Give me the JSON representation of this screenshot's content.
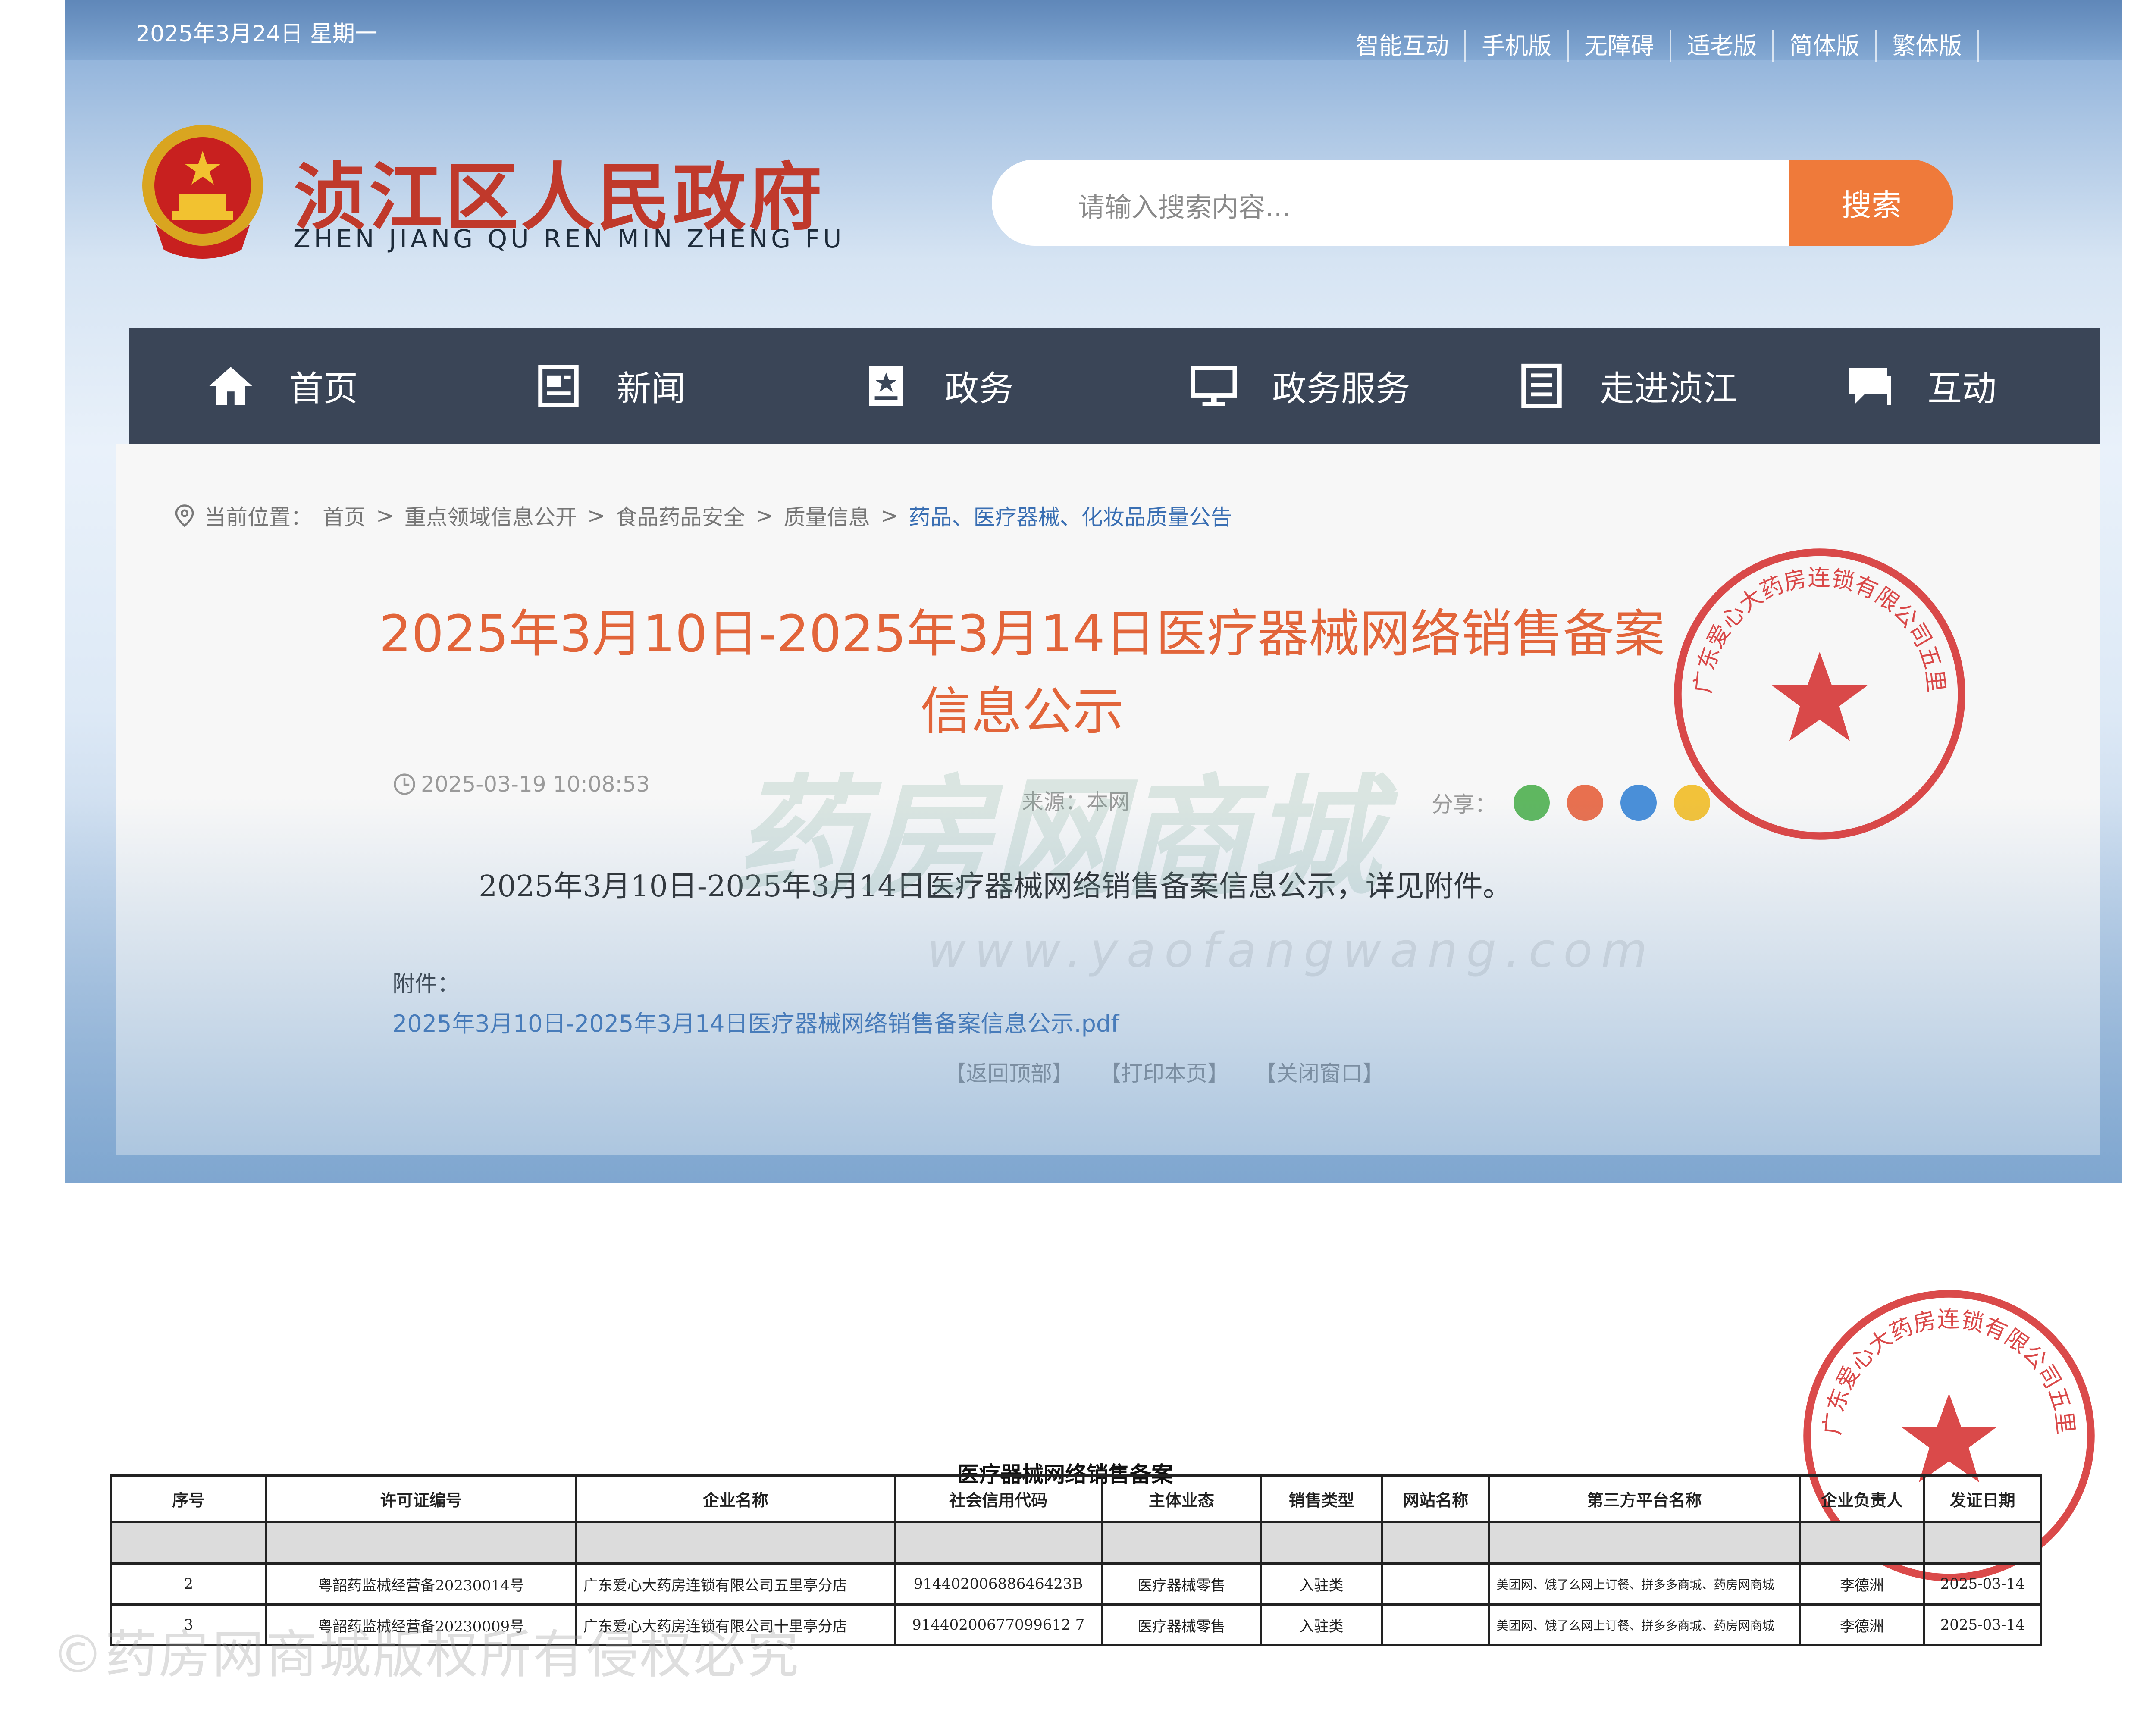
{
  "topbar": {
    "date": "2025年3月24日  星期一",
    "links": [
      "智能互动",
      "手机版",
      "无障碍",
      "适老版",
      "简体版",
      "繁体版"
    ]
  },
  "header": {
    "title": "浈江区人民政府",
    "pinyin": "ZHEN JIANG QU REN MIN ZHENG FU",
    "emblem_icon": "national-emblem-icon"
  },
  "search": {
    "placeholder": "请输入搜索内容...",
    "button_label": "搜索"
  },
  "nav": {
    "items": [
      {
        "label": "首页",
        "icon": "home-icon"
      },
      {
        "label": "新闻",
        "icon": "news-icon"
      },
      {
        "label": "政务",
        "icon": "government-icon"
      },
      {
        "label": "政务服务",
        "icon": "monitor-icon"
      },
      {
        "label": "走进浈江",
        "icon": "building-icon"
      },
      {
        "label": "互动",
        "icon": "chat-icon"
      }
    ]
  },
  "breadcrumb": {
    "prefix": "当前位置：",
    "items": [
      "首页",
      "重点领域信息公开",
      "食品药品安全",
      "质量信息",
      "药品、医疗器械、化妆品质量公告"
    ],
    "separator": ">"
  },
  "article": {
    "title": "2025年3月10日-2025年3月14日医疗器械网络销售备案信息公示",
    "date": "2025-03-19 10:08:53",
    "source": "来源：本网",
    "share_label": "分享：",
    "body": "2025年3月10日-2025年3月14日医疗器械网络销售备案信息公示，详见附件。",
    "attachment_label": "附件：",
    "attachment_link": "2025年3月10日-2025年3月14日医疗器械网络销售备案信息公示.pdf",
    "footer_links": [
      "【返回顶部】",
      "【打印本页】",
      "【关闭窗口】"
    ]
  },
  "watermark": {
    "brand": "药房网商城",
    "url": "www.yaofangwang.com",
    "copyright": "©药房网商城版权所有侵权必究"
  },
  "stamp": {
    "text": "广东爱心大药房连锁有限公司五里亭分店",
    "color": "#d42a2a"
  },
  "colors": {
    "nav_bg": "#3a4557",
    "search_button": "#ef7a3a",
    "title_accent": "#e2653a",
    "gov_title": "#c0392b",
    "link": "#3a6fb3"
  },
  "record_table": {
    "title": "医疗器械网络销售备案",
    "headers": [
      "序号",
      "许可证编号",
      "企业名称",
      "社会信用代码",
      "主体业态",
      "销售类型",
      "网站名称",
      "第三方平台名称",
      "企业负责人",
      "发证日期"
    ],
    "rows": [
      [
        "2",
        "粤韶药监械经营备20230014号",
        "广东爱心大药房连锁有限公司五里亭分店",
        "91440200688646423B",
        "医疗器械零售",
        "入驻类",
        "",
        "美团网、饿了么网上订餐、拼多多商城、药房网商城",
        "李德洲",
        "2025-03-14"
      ],
      [
        "3",
        "粤韶药监械经营备20230009号",
        "广东爱心大药房连锁有限公司十里亭分店",
        "91440200677099612 7",
        "医疗器械零售",
        "入驻类",
        "",
        "美团网、饿了么网上订餐、拼多多商城、药房网商城",
        "李德洲",
        "2025-03-14"
      ]
    ]
  }
}
